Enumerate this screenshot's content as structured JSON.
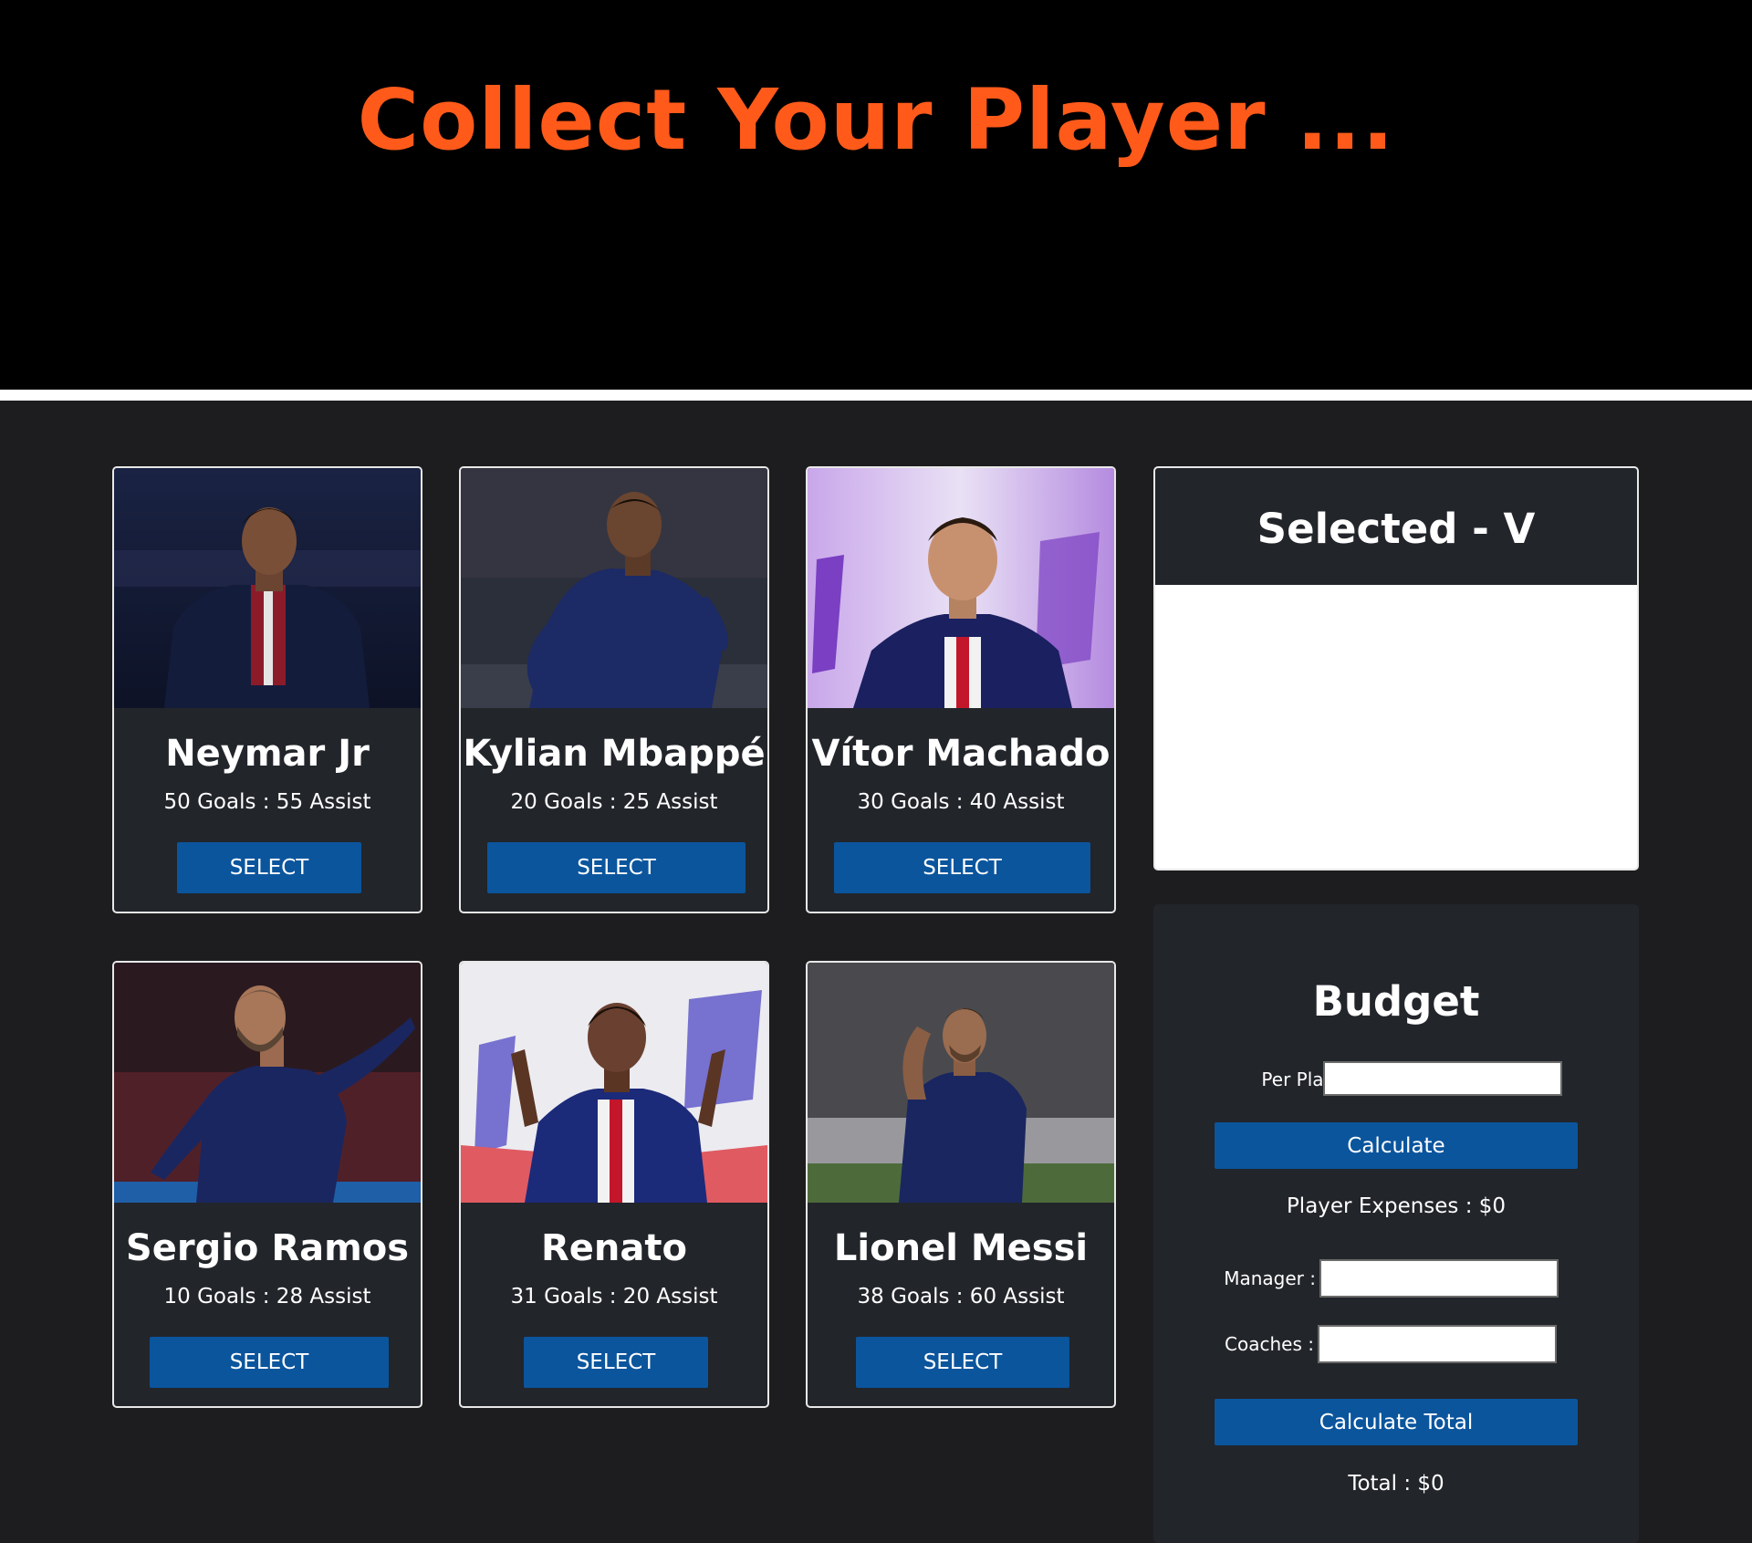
{
  "header": {
    "title": "Collect Your Player ..."
  },
  "players": [
    {
      "name": "Neymar Jr",
      "stats": "50 Goals : 55 Assist",
      "button": "SELECT"
    },
    {
      "name": "Kylian Mbappé",
      "stats": "20 Goals : 25 Assist",
      "button": "SELECT"
    },
    {
      "name": "Vítor Machado",
      "stats": "30 Goals : 40 Assist",
      "button": "SELECT"
    },
    {
      "name": "Sergio Ramos",
      "stats": "10 Goals : 28 Assist",
      "button": "SELECT"
    },
    {
      "name": "Renato",
      "stats": "31 Goals : 20 Assist",
      "button": "SELECT"
    },
    {
      "name": "Lionel Messi",
      "stats": "38 Goals : 60 Assist",
      "button": "SELECT"
    }
  ],
  "selected": {
    "title": "Selected - V"
  },
  "budget": {
    "title": "Budget",
    "per_player_label": "Per Player :",
    "per_player_value": "",
    "calculate_label": "Calculate",
    "player_expenses": "Player Expenses : $0",
    "manager_label": "Manager :",
    "manager_value": "",
    "coaches_label": "Coaches :",
    "coaches_value": "",
    "calculate_total_label": "Calculate Total",
    "total": "Total : $0"
  },
  "colors": {
    "accent": "#ff5a1a",
    "button": "#0b559d",
    "card_bg": "#22252a",
    "page_bg": "#1d1d1f",
    "header_bg": "#000000"
  }
}
